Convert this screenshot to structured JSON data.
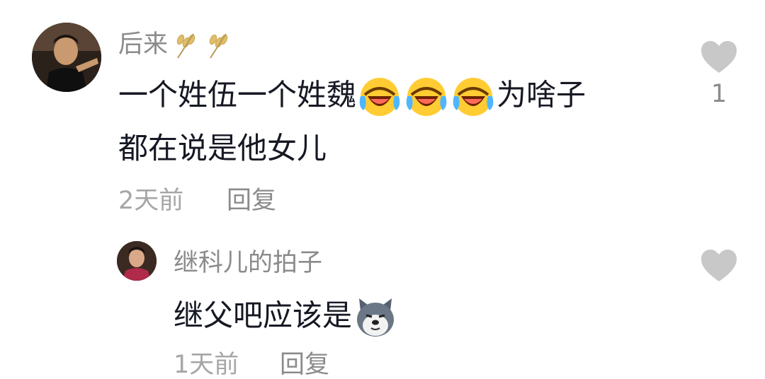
{
  "comments": [
    {
      "username": "后来",
      "username_badges": [
        "wheat-icon",
        "wheat-icon"
      ],
      "text_line1_before": "一个姓伍一个姓魏",
      "emojis": [
        "laughing-tears-emoji",
        "laughing-tears-emoji",
        "laughing-tears-emoji"
      ],
      "text_line1_after": "为啥子",
      "text_line2": "都在说是他女儿",
      "time": "2天前",
      "reply_label": "回复",
      "like_count": "1"
    }
  ],
  "reply": {
    "username": "继科儿的拍子",
    "text": "继父吧应该是",
    "emoji": "husky-dog-emoji",
    "time_partial": "1天前",
    "reply_label_partial": "回复"
  },
  "colors": {
    "username": "#8b8b8b",
    "body": "#161823",
    "meta": "#a6a6a6",
    "heart": "#c8c8c8"
  }
}
